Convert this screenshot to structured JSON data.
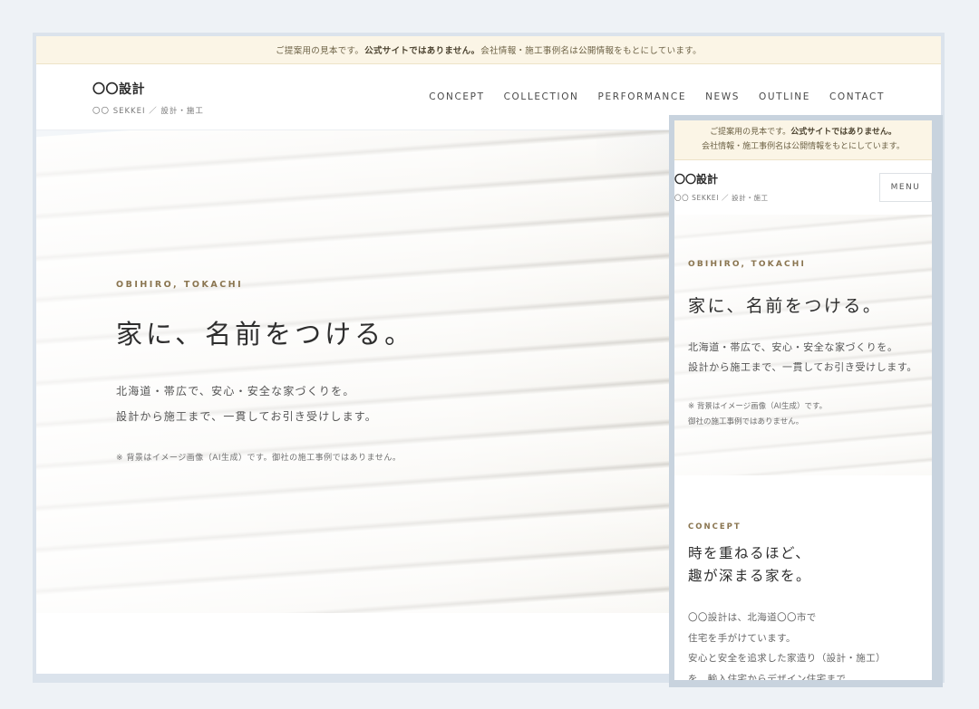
{
  "notice": {
    "pre": "ご提案用の見本です。",
    "bold": "公式サイトではありません。",
    "post": "会社情報・施工事例名は公開情報をもとにしています。"
  },
  "brand": {
    "name": "〇〇設計",
    "sub": "〇〇 SEKKEI ／ 設計・施工"
  },
  "nav": [
    "CONCEPT",
    "COLLECTION",
    "PERFORMANCE",
    "NEWS",
    "OUTLINE",
    "CONTACT"
  ],
  "hero": {
    "kicker": "OBIHIRO, TOKACHI",
    "title": "家に、名前をつける。",
    "lead_1": "北海道・帯広で、安心・安全な家づくりを。",
    "lead_2": "設計から施工まで、一貫してお引き受けします。",
    "note": "※ 背景はイメージ画像（AI生成）です。御社の施工事例ではありません。",
    "note_line1": "※ 背景はイメージ画像（AI生成）です。",
    "note_line2": "御社の施工事例ではありません。"
  },
  "mobile": {
    "notice_line1_pre": "ご提案用の見本です。",
    "notice_line1_bold": "公式サイトではありません。",
    "notice_line2": "会社情報・施工事例名は公開情報をもとにしています。",
    "menu_label": "MENU"
  },
  "concept": {
    "kicker": "CONCEPT",
    "heading_1": "時を重ねるほど、",
    "heading_2": "趣が深まる家を。",
    "body": [
      "〇〇設計は、北海道〇〇市で",
      "住宅を手がけています。",
      "安心と安全を追求した家造り（設計・施工）",
      "を、輸入住宅からデザイン住宅まで。"
    ]
  }
}
